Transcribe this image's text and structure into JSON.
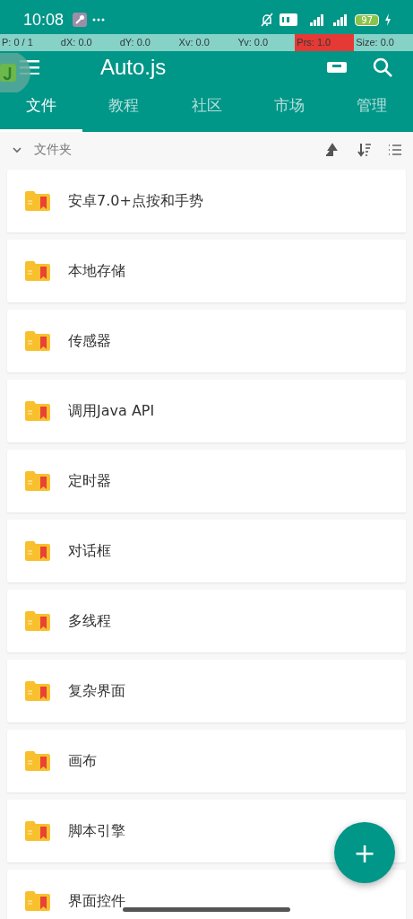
{
  "status_bar": {
    "time": "10:08",
    "battery": "97"
  },
  "pointer_overlay": [
    {
      "text": "P: 0 / 1",
      "highlighted": false
    },
    {
      "text": "dX: 0.0",
      "highlighted": false
    },
    {
      "text": "dY: 0.0",
      "highlighted": false
    },
    {
      "text": "Xv: 0.0",
      "highlighted": false
    },
    {
      "text": "Yv: 0.0",
      "highlighted": false
    },
    {
      "text": "Prs: 1.0",
      "highlighted": true
    },
    {
      "text": "Size: 0.0",
      "highlighted": false
    }
  ],
  "app_bar": {
    "title": "Auto.js"
  },
  "tabs": [
    {
      "label": "文件",
      "selected": true
    },
    {
      "label": "教程",
      "selected": false
    },
    {
      "label": "社区",
      "selected": false
    },
    {
      "label": "市场",
      "selected": false
    },
    {
      "label": "管理",
      "selected": false
    }
  ],
  "section": {
    "title": "文件夹",
    "expanded": true
  },
  "folders": [
    {
      "name": "安卓7.0+点按和手势"
    },
    {
      "name": "本地存储"
    },
    {
      "name": "传感器"
    },
    {
      "name": "调用Java API"
    },
    {
      "name": "定时器"
    },
    {
      "name": "对话框"
    },
    {
      "name": "多线程"
    },
    {
      "name": "复杂界面"
    },
    {
      "name": "画布"
    },
    {
      "name": "脚本引擎"
    },
    {
      "name": "界面控件"
    }
  ],
  "fab": {
    "label": "+"
  }
}
